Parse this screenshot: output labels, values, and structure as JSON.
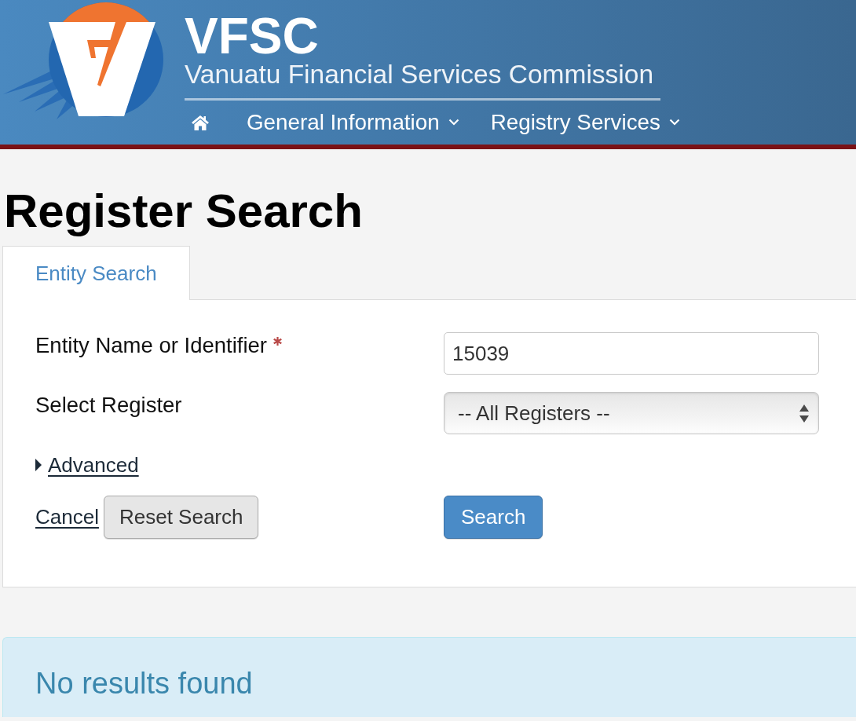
{
  "header": {
    "logo_title": "VFSC",
    "logo_subtitle": "Vanuatu Financial Services Commission",
    "nav": [
      {
        "kind": "home"
      },
      {
        "kind": "menu",
        "label": "General Information"
      },
      {
        "kind": "menu",
        "label": "Registry Services"
      }
    ]
  },
  "page_title": "Register Search",
  "tabs": [
    {
      "label": "Entity Search",
      "selected": true
    }
  ],
  "form": {
    "fields": [
      {
        "kind": "text",
        "label": "Entity Name or Identifier",
        "required": true,
        "value": "15039"
      },
      {
        "kind": "select",
        "label": "Select Register",
        "required": false,
        "value": "-- All Registers --"
      }
    ],
    "advanced": {
      "label": "Advanced",
      "expanded": false
    },
    "cancel": "Cancel",
    "reset": "Reset Search",
    "submit": "Search"
  },
  "alert": {
    "text": "No results found"
  }
}
